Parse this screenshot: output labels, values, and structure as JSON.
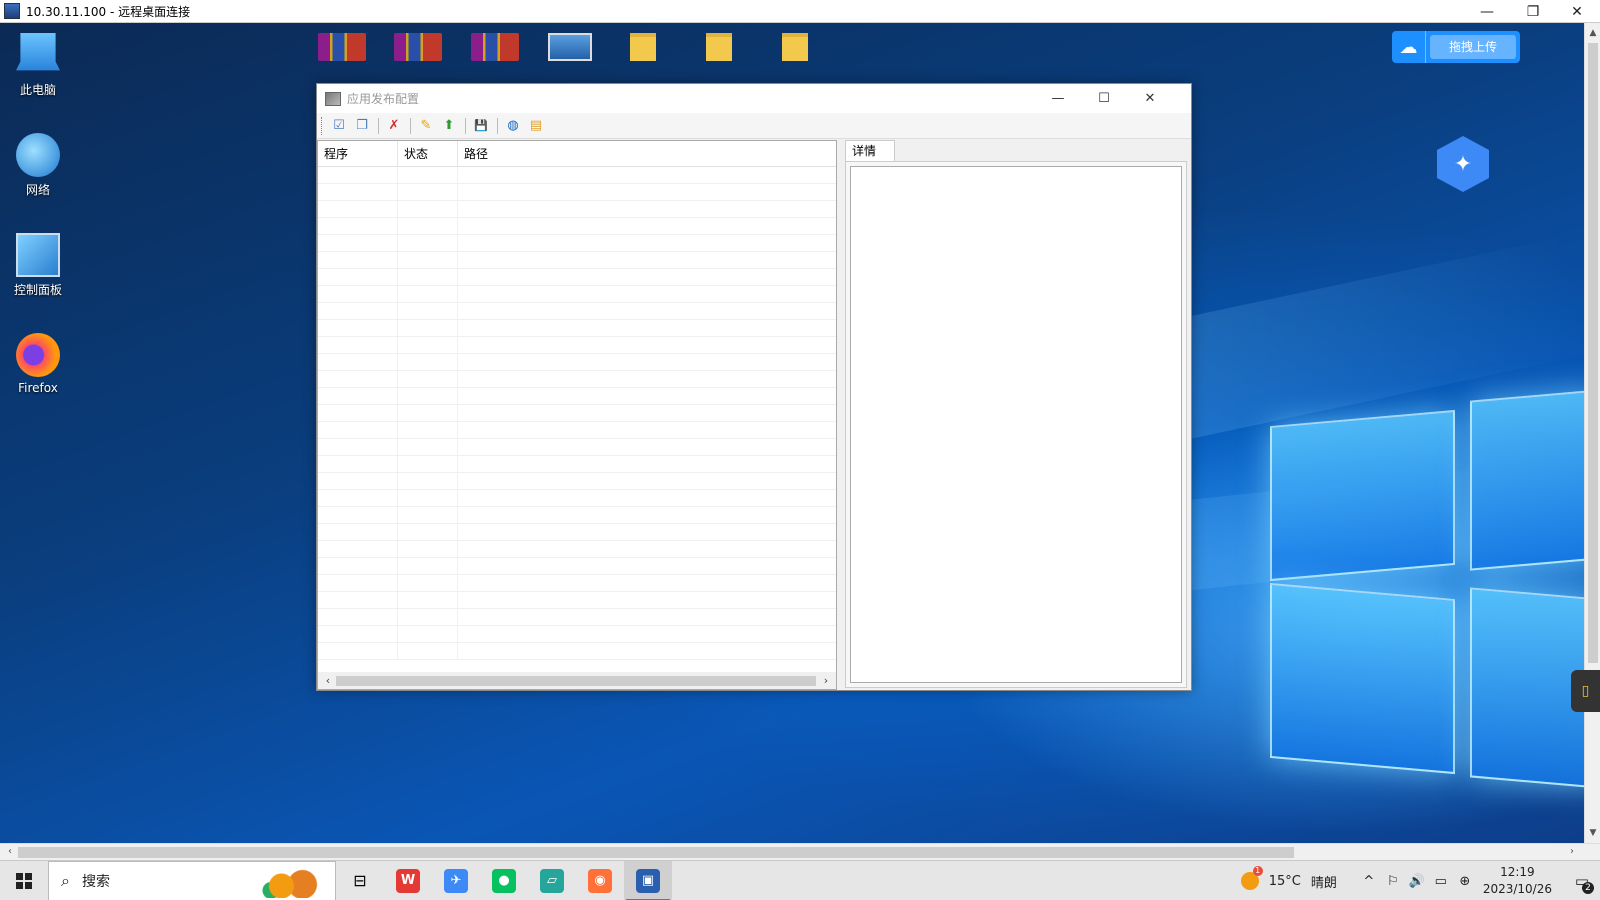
{
  "rdp": {
    "title": "10.30.11.100 - 远程桌面连接",
    "minimize": "—",
    "restore": "❐",
    "close": "✕"
  },
  "desktop": {
    "icons": [
      {
        "label": "此电脑"
      },
      {
        "label": "网络"
      },
      {
        "label": "控制面板"
      },
      {
        "label": "Firefox"
      }
    ],
    "upload_button": {
      "icon": "☁",
      "label": "拖拽上传"
    }
  },
  "app_window": {
    "title": "应用发布配置",
    "minimize": "—",
    "maximize": "☐",
    "close": "✕",
    "toolbar": {
      "new": "☑",
      "copy": "❐",
      "delete": "✗",
      "edit": "✎",
      "upload": "⬆",
      "save": "💾",
      "globe": "◍",
      "export": "▤"
    },
    "list": {
      "columns": [
        "程序",
        "状态",
        "路径"
      ],
      "rows": []
    },
    "detail": {
      "tab_label": "详情"
    }
  },
  "taskbar": {
    "search_icon": "⌕",
    "search_label": "搜索",
    "task_view": "⊟",
    "apps": [
      {
        "name": "wps",
        "glyph": "W",
        "color": "#e53935"
      },
      {
        "name": "feishu",
        "glyph": "✈",
        "color": "#3d8af7"
      },
      {
        "name": "wechat",
        "glyph": "●",
        "color": "#07c160"
      },
      {
        "name": "notes",
        "glyph": "▱",
        "color": "#26a69a"
      },
      {
        "name": "firefox",
        "glyph": "◉",
        "color": "#ff7139"
      },
      {
        "name": "remote-desktop",
        "glyph": "▣",
        "color": "#2a5fb0"
      }
    ],
    "weather": {
      "temp": "15°C",
      "condition": "晴朗"
    },
    "tray_icons": [
      "^",
      "⚐",
      "🔊",
      "▭",
      "⊕"
    ],
    "clock": {
      "time": "12:19",
      "date": "2023/10/26"
    },
    "notification_count": "2"
  }
}
